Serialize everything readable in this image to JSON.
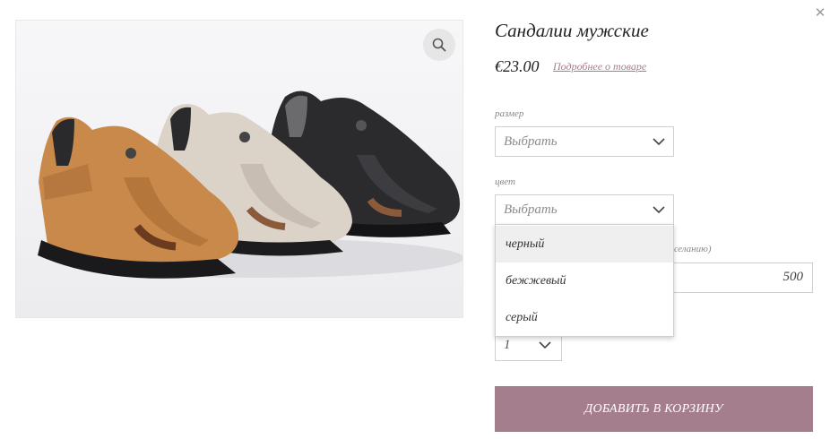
{
  "product": {
    "title": "Сандалии мужские",
    "price": "€23.00",
    "details_link": "Подробнее о товаре",
    "image_alt": "sandals-photo"
  },
  "size_field": {
    "label": "размер",
    "value": "Выбрать"
  },
  "color_field": {
    "label": "цвет",
    "value": "Выбрать",
    "options": [
      "черный",
      "бежжевый",
      "серый"
    ],
    "highlighted_option": "черный"
  },
  "text_field": {
    "label_partial": "желанию)",
    "value": "500"
  },
  "quantity": {
    "value": "1"
  },
  "add_to_cart": {
    "label": "ДОБАВИТЬ В КОРЗИНУ"
  },
  "icons": {
    "close": "close-icon",
    "zoom": "zoom-icon",
    "chevron": "chevron-down-icon"
  },
  "colors": {
    "accent": "#a47e8d",
    "border": "#cfcfcf",
    "muted_text": "#8b8b8b"
  }
}
